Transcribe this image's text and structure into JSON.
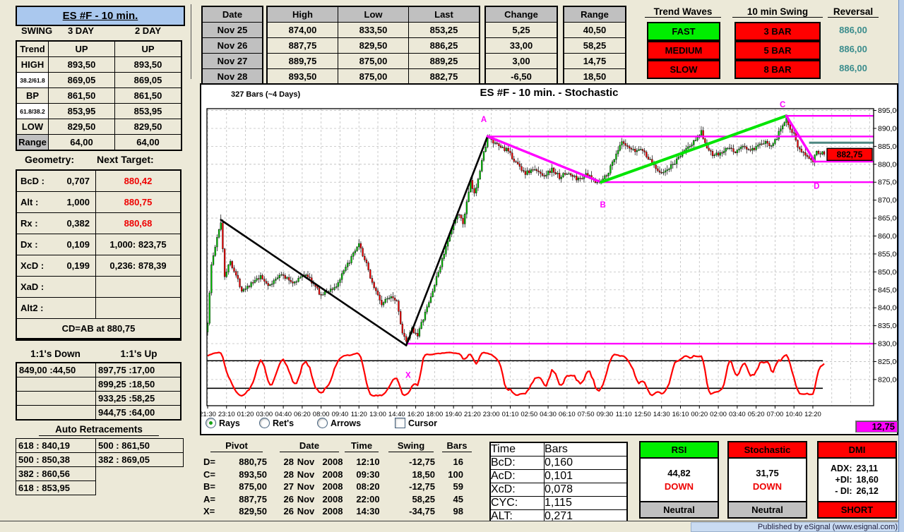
{
  "window": {
    "status_text": "Published by eSignal (www.esignal.com)"
  },
  "sidebar": {
    "title": "ES #F - 10 min.",
    "swing_label": "SWING",
    "col_3day": "3 DAY",
    "col_2day": "2 DAY",
    "swing_rows": [
      {
        "label": "Trend",
        "v1": "UP",
        "v2": "UP",
        "cell": "green",
        "label_style": "plain"
      },
      {
        "label": "HIGH",
        "v1": "893,50",
        "v2": "893,50",
        "cell": "gray",
        "label_style": "plain"
      },
      {
        "label": "38.2/61.8",
        "v1": "869,05",
        "v2": "869,05",
        "cell": "green",
        "label_style": "small"
      },
      {
        "label": "BP",
        "v1": "861,50",
        "v2": "861,50",
        "cell": "green",
        "label_style": "plain"
      },
      {
        "label": "61.8/38.2",
        "v1": "853,95",
        "v2": "853,95",
        "cell": "green",
        "label_style": "small"
      },
      {
        "label": "LOW",
        "v1": "829,50",
        "v2": "829,50",
        "cell": "white",
        "label_style": "plain"
      },
      {
        "label": "Range",
        "v1": "64,00",
        "v2": "64,00",
        "cell": "gray",
        "label_style": "gray"
      }
    ],
    "geometry_title": "Geometry:",
    "target_title": "Next Target:",
    "geometry_rows": [
      {
        "label": "BcD :",
        "value": "0,707",
        "bg": "green",
        "target": "880,42",
        "tbg": "white",
        "tred": true
      },
      {
        "label": "Alt :",
        "value": "1,000",
        "bg": "green",
        "target": "880,75",
        "tbg": "white",
        "tred": true
      },
      {
        "label": "Rx :",
        "value": "0,382",
        "bg": "yellow",
        "target": "880,68",
        "tbg": "white",
        "tred": true
      },
      {
        "label": "Dx :",
        "value": "0,109",
        "bg": "gray",
        "target": "1,000: 823,75",
        "tbg": "gray",
        "tred": false
      },
      {
        "label": "XcD :",
        "value": "0,199",
        "bg": "gray",
        "target": "0,236: 878,39",
        "tbg": "gray",
        "tred": false
      },
      {
        "label": "XaD :",
        "value": "",
        "bg": "white",
        "target": "",
        "tbg": "white",
        "tred": false
      },
      {
        "label": "Alt2 :",
        "value": "",
        "bg": "white",
        "target": "",
        "tbg": "white",
        "tred": false
      }
    ],
    "geometry_footer": "CD=AB at 880,75",
    "ratio_down_title": "1:1's Down",
    "ratio_up_title": "1:1's Up",
    "ratio_down": [
      "849,00 :44,50",
      "",
      "",
      ""
    ],
    "ratio_up": [
      "897,75 :17,00",
      "899,25 :18,50",
      "933,25 :58,25",
      "944,75 :64,00"
    ],
    "auto_title": "Auto Retracements",
    "auto_left": [
      {
        "text": "618 : 840,19",
        "bg": "cyan"
      },
      {
        "text": "500 : 850,38",
        "bg": "red"
      },
      {
        "text": "382 : 860,56",
        "bg": "yellow"
      },
      {
        "text": "618 : 853,95",
        "bg": "cyan"
      }
    ],
    "auto_right": [
      {
        "text": "500 : 861,50",
        "bg": "red"
      },
      {
        "text": "382 : 869,05",
        "bg": "yellow"
      }
    ]
  },
  "daily": {
    "date_header": "Date",
    "dates": [
      "Nov 25",
      "Nov 26",
      "Nov 27",
      "Nov 28"
    ],
    "high_header": "High",
    "low_header": "Low",
    "last_header": "Last",
    "high": [
      {
        "v": "874,00",
        "bg": "green"
      },
      {
        "v": "887,75",
        "bg": "green"
      },
      {
        "v": "889,75",
        "bg": "cyan"
      },
      {
        "v": "893,50",
        "bg": "green"
      }
    ],
    "low": [
      {
        "v": "833,50",
        "bg": "green"
      },
      {
        "v": "829,50",
        "bg": "red"
      },
      {
        "v": "875,00",
        "bg": "green"
      },
      {
        "v": "875,00",
        "bg": "cyan"
      }
    ],
    "last": [
      {
        "v": "853,25",
        "bg": "green"
      },
      {
        "v": "886,25",
        "bg": "green"
      },
      {
        "v": "889,25",
        "bg": "green"
      },
      {
        "v": "882,75",
        "bg": "red"
      }
    ],
    "change_header": "Change",
    "change": [
      {
        "v": "5,25",
        "bg": "green"
      },
      {
        "v": "33,00",
        "bg": "green"
      },
      {
        "v": "3,00",
        "bg": "green"
      },
      {
        "v": "-6,50",
        "bg": "red"
      }
    ],
    "range_header": "Range",
    "range": [
      {
        "v": "40,50",
        "bg": "yellow"
      },
      {
        "v": "58,25",
        "bg": "yellow"
      },
      {
        "v": "14,75",
        "bg": "yellow"
      },
      {
        "v": "18,50",
        "bg": "yellow"
      }
    ]
  },
  "trend_panel": {
    "waves_title": "Trend Waves",
    "waves": [
      {
        "label": "FAST",
        "bg": "green"
      },
      {
        "label": "MEDIUM",
        "bg": "red"
      },
      {
        "label": "SLOW",
        "bg": "red"
      }
    ],
    "swing_title": "10 min Swing",
    "swing": [
      {
        "label": "3 BAR",
        "bg": "red"
      },
      {
        "label": "5 BAR",
        "bg": "red"
      },
      {
        "label": "8 BAR",
        "bg": "red"
      }
    ],
    "reversal_title": "Reversal",
    "reversal": [
      "886,00",
      "886,00",
      "886,00"
    ]
  },
  "chart": {
    "bars_label": "327 Bars (~4 Days)",
    "title": "ES #F - 10 min. - Stochastic",
    "controls": {
      "rays": "Rays",
      "rets": "Ret's",
      "arrows": "Arrows",
      "cursor": "Cursor"
    },
    "corner_value": "12,75"
  },
  "chart_data": {
    "type": "candlestick",
    "title": "ES #F - 10 min. - Stochastic",
    "bar_count": 327,
    "interval": "10 min",
    "ylim": [
      812.7,
      895.5
    ],
    "y_ticks": [
      895,
      890,
      885,
      880,
      875,
      870,
      865,
      860,
      855,
      850,
      845,
      840,
      835,
      830,
      825,
      820
    ],
    "x_tick_labels": [
      "21:30",
      "23:10",
      "01:20",
      "03:00",
      "04:40",
      "06:20",
      "08:00",
      "09:40",
      "11:20",
      "13:00",
      "14:40",
      "16:20",
      "18:00",
      "19:40",
      "21:20",
      "23:00",
      "01:10",
      "02:50",
      "04:30",
      "06:10",
      "07:50",
      "09:30",
      "11:10",
      "12:50",
      "14:30",
      "16:10",
      "00:20",
      "02:00",
      "03:40",
      "05:20",
      "07:00",
      "10:40",
      "12:20"
    ],
    "price_waypoints": [
      [
        0,
        836
      ],
      [
        2,
        852
      ],
      [
        4,
        857
      ],
      [
        7,
        864
      ],
      [
        9,
        849
      ],
      [
        12,
        853
      ],
      [
        18,
        845
      ],
      [
        24,
        847
      ],
      [
        28,
        848.5
      ],
      [
        33,
        846
      ],
      [
        38,
        849.5
      ],
      [
        45,
        847
      ],
      [
        52,
        849.5
      ],
      [
        60,
        843.5
      ],
      [
        68,
        846
      ],
      [
        75,
        853
      ],
      [
        80,
        857.5
      ],
      [
        84,
        852
      ],
      [
        87,
        847
      ],
      [
        92,
        841
      ],
      [
        97,
        843.5
      ],
      [
        100,
        842
      ],
      [
        103,
        833
      ],
      [
        105,
        830.2
      ],
      [
        108,
        834
      ],
      [
        111,
        832.5
      ],
      [
        118,
        843
      ],
      [
        124,
        853.5
      ],
      [
        128,
        860
      ],
      [
        132,
        866.5
      ],
      [
        135,
        863.5
      ],
      [
        139,
        875
      ],
      [
        141,
        871.5
      ],
      [
        145,
        881
      ],
      [
        148,
        887.5
      ],
      [
        152,
        885.5
      ],
      [
        158,
        884
      ],
      [
        163,
        880.5
      ],
      [
        168,
        877.5
      ],
      [
        172,
        878.5
      ],
      [
        178,
        877
      ],
      [
        182,
        878.5
      ],
      [
        186,
        876.5
      ],
      [
        190,
        877.5
      ],
      [
        196,
        875.8
      ],
      [
        200,
        877
      ],
      [
        205,
        875.4
      ],
      [
        208,
        875.2
      ],
      [
        212,
        878
      ],
      [
        216,
        883
      ],
      [
        219,
        886
      ],
      [
        222,
        884.5
      ],
      [
        226,
        883.5
      ],
      [
        229,
        884.5
      ],
      [
        234,
        881
      ],
      [
        238,
        878.5
      ],
      [
        241,
        877.5
      ],
      [
        245,
        879.5
      ],
      [
        249,
        881.5
      ],
      [
        252,
        884
      ],
      [
        256,
        885.5
      ],
      [
        259,
        888
      ],
      [
        261,
        889
      ],
      [
        264,
        884.5
      ],
      [
        267,
        882.5
      ],
      [
        271,
        882.8
      ],
      [
        275,
        884.5
      ],
      [
        279,
        883.5
      ],
      [
        283,
        885
      ],
      [
        287,
        883.8
      ],
      [
        290,
        884.5
      ],
      [
        294,
        886
      ],
      [
        298,
        885.5
      ],
      [
        301,
        887.5
      ],
      [
        304,
        891
      ],
      [
        306,
        893
      ],
      [
        308,
        890
      ],
      [
        310,
        888.5
      ],
      [
        312,
        884.5
      ],
      [
        314,
        883
      ],
      [
        317,
        882.5
      ],
      [
        320,
        881.2
      ],
      [
        322,
        883.8
      ],
      [
        324,
        883.2
      ],
      [
        326,
        882.75
      ]
    ],
    "forced_points": [
      {
        "bar": 7,
        "type": "high",
        "value": 866
      },
      {
        "bar": 105,
        "type": "low",
        "value": 829.5
      },
      {
        "bar": 148,
        "type": "high",
        "value": 888.3
      },
      {
        "bar": 306,
        "type": "high",
        "value": 893.5
      },
      {
        "bar": 320,
        "type": "low",
        "value": 880.75
      },
      {
        "bar": 326,
        "type": "close",
        "value": 882.75
      }
    ],
    "pivots": {
      "X": 829.5,
      "A": 887.75,
      "B": 875.0,
      "C": 893.5,
      "D": 880.75
    },
    "segments": [
      {
        "color": "#000000",
        "w": 2.6,
        "from": [
          7,
          864.5
        ],
        "to": [
          105,
          829.5
        ]
      },
      {
        "color": "#000000",
        "w": 2.6,
        "from": [
          105,
          829.5
        ],
        "to": [
          148,
          887.8
        ]
      },
      {
        "color": "#ff00ff",
        "w": 3.4,
        "from": [
          148,
          887.8
        ],
        "to": [
          208,
          875.0
        ]
      },
      {
        "color": "#00e400",
        "w": 4,
        "from": [
          208,
          875.0
        ],
        "to": [
          306,
          893.5
        ]
      },
      {
        "color": "#ff00ff",
        "w": 3.4,
        "from": [
          306,
          893.5
        ],
        "to": [
          321,
          880.75
        ]
      }
    ],
    "h_lines": [
      {
        "price": 893.5,
        "from_bar": 306,
        "color": "#ff00ff",
        "w": 2.4
      },
      {
        "price": 887.75,
        "from_bar": 148,
        "color": "#ff00ff",
        "w": 2.4
      },
      {
        "price": 875.0,
        "from_bar": 208,
        "color": "#ff00ff",
        "w": 2.4
      },
      {
        "price": 830.0,
        "from_bar": 105,
        "color": "#ff00ff",
        "w": 2.4
      },
      {
        "price": 880.75,
        "from_bar": 321,
        "color": "#ff00ff",
        "w": 2.4
      },
      {
        "price": 886.0,
        "from_bar": 318,
        "color": "#4e8782",
        "w": 3
      }
    ],
    "pivot_labels": [
      {
        "text": "A",
        "bar": 146,
        "price": 891.8
      },
      {
        "text": "B",
        "bar": 209,
        "price": 868.0
      },
      {
        "text": "C",
        "bar": 304,
        "price": 895.9
      },
      {
        "text": "D",
        "bar": 322,
        "price": 873.2
      },
      {
        "text": "X",
        "bar": 106,
        "price": 820.5
      }
    ],
    "stochastic": {
      "lookback": 10,
      "smooth": 3,
      "ref_high": 80,
      "ref_low": 20,
      "color": "#ff0000",
      "scale_base": 815,
      "scale_per_unit": 0.128
    },
    "last_price": 882.75,
    "last_price_label": "882,75"
  },
  "pivot_table": {
    "headers": {
      "pivot": "Pivot",
      "date": "Date",
      "time": "Time",
      "swing": "Swing",
      "bars": "Bars"
    },
    "rows": [
      {
        "label": "D=",
        "pivot": "880,75",
        "day": "28",
        "mon": "Nov",
        "year": "2008",
        "time": "12:10",
        "swing": "-12,75",
        "bars": "16"
      },
      {
        "label": "C=",
        "pivot": "893,50",
        "day": "28",
        "mon": "Nov",
        "year": "2008",
        "time": "09:30",
        "swing": "18,50",
        "bars": "100"
      },
      {
        "label": "B=",
        "pivot": "875,00",
        "day": "27",
        "mon": "Nov",
        "year": "2008",
        "time": "08:20",
        "swing": "-12,75",
        "bars": "59"
      },
      {
        "label": "A=",
        "pivot": "887,75",
        "day": "26",
        "mon": "Nov",
        "year": "2008",
        "time": "22:00",
        "swing": "58,25",
        "bars": "45"
      },
      {
        "label": "X=",
        "pivot": "829,50",
        "day": "26",
        "mon": "Nov",
        "year": "2008",
        "time": "14:30",
        "swing": "-34,75",
        "bars": "98"
      }
    ]
  },
  "time_bars": {
    "time_header": "Time",
    "bars_header": "Bars",
    "rows": [
      {
        "label": "BcD:",
        "value": "0,160"
      },
      {
        "label": "AcD:",
        "value": "0,101"
      },
      {
        "label": "XcD:",
        "value": "0,078"
      },
      {
        "label": "CYC:",
        "value": "1,115"
      },
      {
        "label": "ALT:",
        "value": "0,271"
      }
    ]
  },
  "indicators": {
    "rsi": {
      "title": "RSI",
      "title_bg": "green",
      "value": "44,82",
      "direction": "DOWN",
      "footer": "Neutral",
      "footer_bg": "gray"
    },
    "stochastic": {
      "title": "Stochastic",
      "title_bg": "red",
      "value": "31,75",
      "direction": "DOWN",
      "footer": "Neutral",
      "footer_bg": "gray"
    },
    "dmi": {
      "title": "DMI",
      "title_bg": "red",
      "adx_label": "ADX:",
      "adx": "23,11",
      "pdi_label": "+DI:",
      "pdi": "18,60",
      "mdi_label": "- DI:",
      "mdi": "26,12",
      "footer": "SHORT",
      "footer_bg": "red"
    }
  }
}
